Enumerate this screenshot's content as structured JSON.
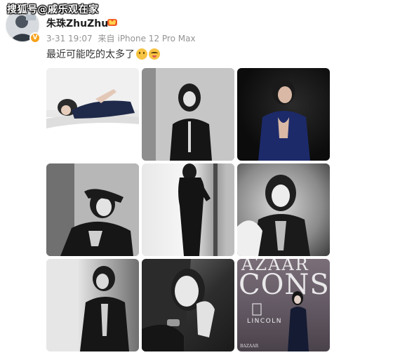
{
  "watermark": "搜狐号@戚乐观在家",
  "author": {
    "name": "朱珠ZhuZhu",
    "avatar_icon": "avatar-photo",
    "verified_icon": "verified-badge-icon",
    "vip_icon": "vip-crown-icon",
    "badge_color": "#f7a21b"
  },
  "meta": {
    "time": "3-31 19:07",
    "source_prefix": "来自",
    "device": "iPhone 12 Pro Max"
  },
  "post": {
    "text": "最近可能吃的太多了",
    "emojis": [
      "thinking-emoji",
      "sigh-emoji"
    ]
  },
  "photos": [
    {
      "id": "photo-1",
      "desc": "woman-lying-on-bed"
    },
    {
      "id": "photo-2",
      "desc": "woman-standing-by-wall"
    },
    {
      "id": "photo-3",
      "desc": "woman-sequin-jacket-dark"
    },
    {
      "id": "photo-4",
      "desc": "woman-hands-behind-head"
    },
    {
      "id": "photo-5",
      "desc": "woman-by-window"
    },
    {
      "id": "photo-6",
      "desc": "woman-portrait-chair"
    },
    {
      "id": "photo-7",
      "desc": "woman-side-pose"
    },
    {
      "id": "photo-8",
      "desc": "woman-closeup-hand"
    },
    {
      "id": "photo-9",
      "desc": "woman-at-event-backdrop"
    }
  ],
  "event_cover": {
    "line1": "AZAAR",
    "line2": "CONS",
    "brand": "LINCOLN",
    "foot": "BAZAAR"
  }
}
